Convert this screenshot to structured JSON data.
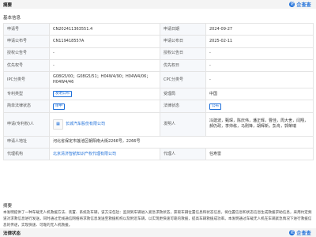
{
  "header": {
    "title": "摘要",
    "brand": "企查查",
    "brand_logo": "企"
  },
  "basic_info": {
    "title": "基本信息",
    "rows": [
      {
        "l1": "申请号",
        "v1": "CN202411363551.4",
        "l2": "申请日期",
        "v2": "2024-09-27"
      },
      {
        "l1": "申请公布号",
        "v1": "CN119418557A",
        "l2": "申请公布日",
        "v2": "2025-02-11"
      },
      {
        "l1": "授权公告号",
        "v1": "-",
        "l2": "授权公告日",
        "v2": "-"
      },
      {
        "l1": "优先权号",
        "v1": "-",
        "l2": "优先权日",
        "v2": "-"
      },
      {
        "l1": "IPC分类号",
        "v1": "G08G5/00；G08G5/51；H04W4/90；H04W4/06；H04W4/46",
        "l2": "CPC分类号",
        "v2": "-"
      },
      {
        "l1": "专利类型",
        "v1": "发明公布",
        "l2": "受理局",
        "v2": "中国"
      },
      {
        "l1": "简单法律状态",
        "v1": "审中",
        "l2": "法律状态",
        "v2": "公布"
      },
      {
        "l1": "申请(专利权)人",
        "v1": "长城汽车股份有限公司",
        "l2": "发明人",
        "v2": "冯建波，甄琛，陈庆伟，潘正辉，曹佳，周大舍，闫翔，郝仍政，李帅栋，马刚锋，胡辉新，彭舟，郭荣瑞"
      },
      {
        "l1": "申请人地址",
        "v1": "河北省保定市莲池区朝阳南大街2266号，2266号",
        "l2": "",
        "v2": ""
      },
      {
        "l1": "代理机构",
        "v1": "北京清济智航知识产权代理有限公司",
        "l2": "代理人",
        "v2": "任寿雷"
      }
    ]
  },
  "abstract": {
    "title": "摘要",
    "text": "本发明提供了一种车载无人机救援方法、装置、系统及车辆，该方法包括：监测到车辆进入紧急求救状态，获取车辆位置信息和状态信息，将位置信息和状态信息生成救援求助信息，采用约定频道对求救信息进行发送，同时通过无线通信网络将求救信息发送至救援机构以及附近车辆，以实现更快速可靠的救援，提高车辆救援成功率。本发明通过车载无人机在车辆紧急情况下进行救援信息的传递，实现快速、可靠的无人机救援。"
  },
  "legal_info": {
    "title": "法律状态",
    "brand": "企查查",
    "brand_logo": "企"
  },
  "colors": {
    "accent": "#1e6fd9",
    "label_bg": "#f6f8fb",
    "section_bg": "#f4f4f4",
    "border": "#e4e4e4"
  },
  "icons": {
    "applicant_logo": "building-icon"
  }
}
